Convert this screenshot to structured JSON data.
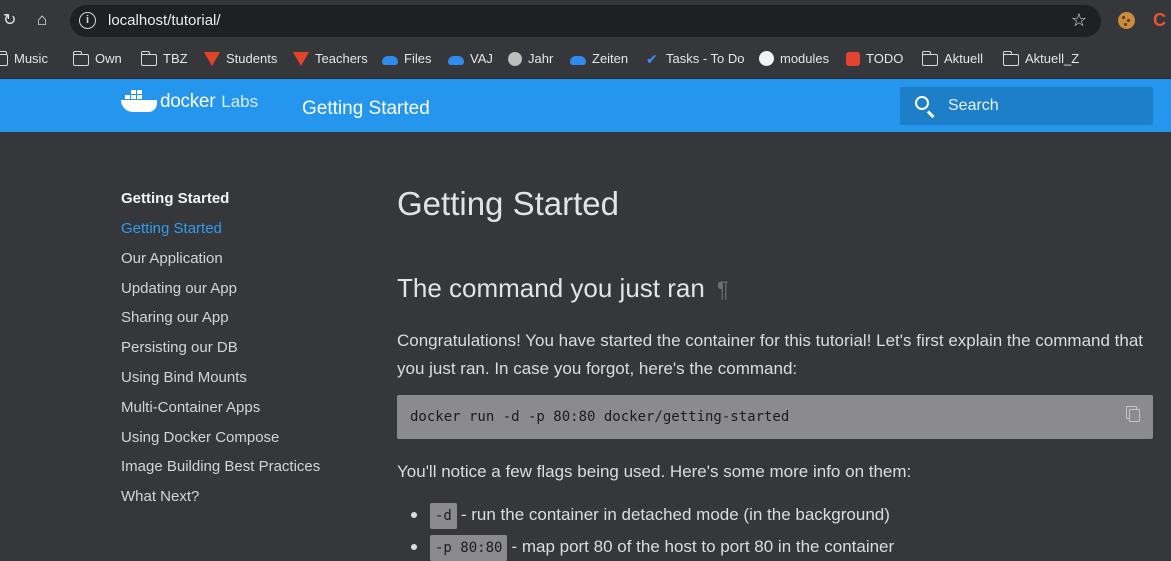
{
  "browser": {
    "url": "localhost/tutorial/",
    "bookmarks": [
      {
        "label": "Music",
        "icon": "folder-icon"
      },
      {
        "label": "Own",
        "icon": "folder-icon"
      },
      {
        "label": "TBZ",
        "icon": "folder-icon"
      },
      {
        "label": "Students",
        "icon": "gitlab-icon"
      },
      {
        "label": "Teachers",
        "icon": "gitlab-icon"
      },
      {
        "label": "Files",
        "icon": "onedrive-icon"
      },
      {
        "label": "VAJ",
        "icon": "onedrive-icon"
      },
      {
        "label": "Jahr",
        "icon": "globe-icon"
      },
      {
        "label": "Zeiten",
        "icon": "onedrive-icon"
      },
      {
        "label": "Tasks - To Do",
        "icon": "check-icon"
      },
      {
        "label": "modules",
        "icon": "github-icon"
      },
      {
        "label": "TODO",
        "icon": "todoist-icon"
      },
      {
        "label": "Aktuell",
        "icon": "folder-icon"
      },
      {
        "label": "Aktuell_Z",
        "icon": "folder-icon"
      }
    ]
  },
  "header": {
    "logo_text": "docker",
    "logo_sub": "Labs",
    "title": "Getting Started",
    "search_placeholder": "Search",
    "accent": "#2496ed"
  },
  "sidebar": {
    "heading": "Getting Started",
    "items": [
      {
        "label": "Getting Started",
        "active": true
      },
      {
        "label": "Our Application"
      },
      {
        "label": "Updating our App"
      },
      {
        "label": "Sharing our App"
      },
      {
        "label": "Persisting our DB"
      },
      {
        "label": "Using Bind Mounts"
      },
      {
        "label": "Multi-Container Apps"
      },
      {
        "label": "Using Docker Compose"
      },
      {
        "label": "Image Building Best Practices"
      },
      {
        "label": "What Next?"
      }
    ]
  },
  "main": {
    "title": "Getting Started",
    "section_title": "The command you just ran",
    "pilcrow": "¶",
    "intro": "Congratulations! You have started the container for this tutorial! Let's first explain the command that you just ran. In case you forgot, here's the command:",
    "command": "docker run -d -p 80:80 docker/getting-started",
    "flags_intro": "You'll notice a few flags being used. Here's some more info on them:",
    "flags": [
      {
        "flag": "-d",
        "text": "- run the container in detached mode (in the background)"
      },
      {
        "flag": "-p 80:80",
        "text": "- map port 80 of the host to port 80 in the container"
      }
    ]
  }
}
